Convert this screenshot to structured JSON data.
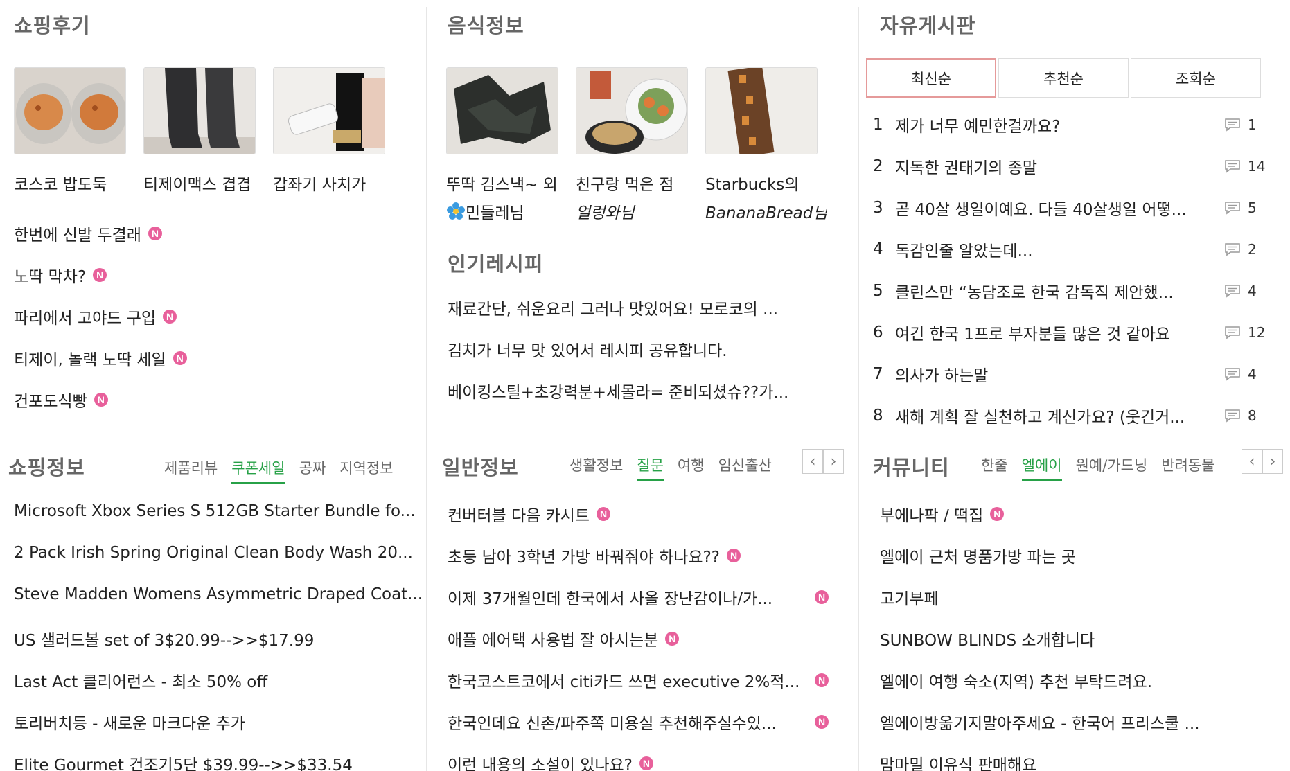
{
  "shopping_review": {
    "title": "쇼핑후기",
    "photos": [
      {
        "caption": "코스코 밥도둑"
      },
      {
        "caption": "티제이맥스 겹겹"
      },
      {
        "caption": "갑좌기 사치가"
      }
    ],
    "list": [
      {
        "text": "한번에 신발 두결래",
        "new": true,
        "badge": "N"
      },
      {
        "text": "노딱 막차?",
        "new": true,
        "badge": "N"
      },
      {
        "text": "파리에서 고야드 구입",
        "new": true,
        "badge": "N"
      },
      {
        "text": "티제이, 놀랙 노딱 세일",
        "new": true,
        "badge": "N"
      },
      {
        "text": "건포도식빵",
        "new": true,
        "badge": "N"
      }
    ]
  },
  "food_info": {
    "title": "음식정보",
    "photos": [
      {
        "caption": "뚜딱 김스낵~ 외",
        "author": "민들레님"
      },
      {
        "caption": "친구랑 먹은 점",
        "author": "얼렁와님"
      },
      {
        "caption": "Starbucks의",
        "author": "BananaBread님"
      }
    ],
    "popular_recipe": {
      "title": "인기레시피",
      "list": [
        "재료간단, 쉬운요리 그러나 맛있어요! 모로코의 ...",
        "김치가 너무 맛 있어서 레시피 공유합니다.",
        "베이킹스틸+초강력분+세몰라= 준비되셨슈??가..."
      ]
    }
  },
  "free_board": {
    "title": "자유게시판",
    "sort_tabs": [
      "최신순",
      "추천순",
      "조회순"
    ],
    "posts": [
      {
        "num": "1",
        "title": "제가 너무 예민한걸까요?",
        "comments": "1"
      },
      {
        "num": "2",
        "title": "지독한 권태기의 종말",
        "comments": "14"
      },
      {
        "num": "3",
        "title": "곧 40살 생일이예요. 다들 40살생일 어떻...",
        "comments": "5"
      },
      {
        "num": "4",
        "title": "독감인줄 알았는데...",
        "comments": "2"
      },
      {
        "num": "5",
        "title": "클린스만 “농담조로 한국 감독직 제안했...",
        "comments": "4"
      },
      {
        "num": "6",
        "title": "여긴 한국 1프로 부자분들 많은 것 같아요",
        "comments": "12"
      },
      {
        "num": "7",
        "title": "의사가 하는말",
        "comments": "4"
      },
      {
        "num": "8",
        "title": "새해 계획 잘 실천하고 계신가요? (웃긴거...",
        "comments": "8"
      }
    ]
  },
  "shopping_info": {
    "title": "쇼핑정보",
    "tabs": [
      "제품리뷰",
      "쿠폰세일",
      "공짜",
      "지역정보"
    ],
    "active_tab": "쿠폰세일",
    "list": [
      "Microsoft Xbox Series S 512GB Starter Bundle fo...",
      "2 Pack Irish Spring Original Clean Body Wash 20...",
      "Steve Madden Womens Asymmetric Draped Coat...",
      "US 샐러드볼 set of 3$20.99-->>$17.99",
      "Last Act 클리어런스 - 최소 50% off",
      "토리버치등 - 새로운 마크다운 추가",
      "Elite Gourmet 건조기5단 $39.99-->>$33.54"
    ]
  },
  "general_info": {
    "title": "일반정보",
    "tabs": [
      "생활정보",
      "질문",
      "여행",
      "임신출산"
    ],
    "active_tab": "질문",
    "arrow_prev": "‹",
    "arrow_next": "›",
    "list": [
      {
        "text": "컨버터블 다음 카시트",
        "new": true,
        "badge": "N"
      },
      {
        "text": "초등 남아 3학년 가방 바꿔줘야 하나요??",
        "new": true,
        "badge": "N"
      },
      {
        "text": "이제 37개월인데 한국에서 사올 장난감이나/가...",
        "new": true,
        "badge": "N"
      },
      {
        "text": "애플 에어택 사용법 잘 아시는분",
        "new": true,
        "badge": "N"
      },
      {
        "text": "한국코스트코에서 citi카드 쓰면 executive 2%적...",
        "new": true,
        "badge": "N"
      },
      {
        "text": "한국인데요 신촌/파주쪽 미용실 추천해주실수있...",
        "new": true,
        "badge": "N"
      },
      {
        "text": "이런 내용의 소설이 있나요?",
        "new": true,
        "badge": "N"
      }
    ]
  },
  "community": {
    "title": "커뮤니티",
    "tabs": [
      "한줄",
      "엘에이",
      "원예/가드닝",
      "반려동물"
    ],
    "active_tab": "엘에이",
    "arrow_prev": "‹",
    "arrow_next": "›",
    "list": [
      {
        "text": "부에나팍 / 떡집",
        "new": true,
        "badge": "N"
      },
      {
        "text": "엘에이 근처 명품가방 파는 곳",
        "new": false
      },
      {
        "text": "고기부페",
        "new": false
      },
      {
        "text": "SUNBOW BLINDS 소개합니다",
        "new": false
      },
      {
        "text": "엘에이 여행 숙소(지역) 추천 부탁드려요.",
        "new": false
      },
      {
        "text": "엘에이방옮기지말아주세요 - 한국어 프리스쿨 ...",
        "new": false
      },
      {
        "text": "맘마밀 이유식 판매해요",
        "new": false
      }
    ]
  },
  "colors": {
    "accent_green": "#27a147",
    "new_badge_pink": "#e8609b",
    "active_sort_border": "#e59a9a"
  }
}
